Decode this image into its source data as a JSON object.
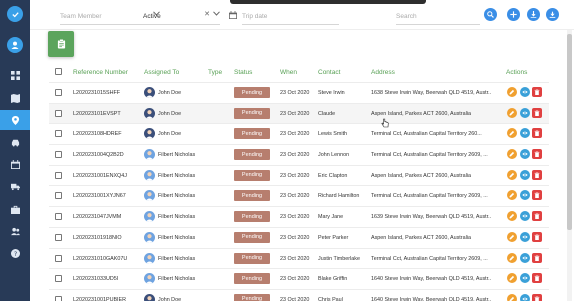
{
  "topbar": {
    "team_member_placeholder": "Team Member",
    "status_value": "Active",
    "trip_date_placeholder": "Trip date",
    "search_placeholder": "Search"
  },
  "table": {
    "headers": {
      "reference": "Reference Number",
      "assigned": "Assigned To",
      "type": "Type",
      "status": "Status",
      "when": "When",
      "contact": "Contact",
      "address": "Address",
      "actions": "Actions"
    },
    "rows": [
      {
        "ref": "L2020231015SHFF",
        "assigned": "John Doe",
        "avatar": "dark",
        "type": "",
        "status": "Pending",
        "when": "23 Oct 2020",
        "contact": "Steve Irwin",
        "address": "1638 Steve Irwin Way, Beerwah QLD 4519, Austr..."
      },
      {
        "ref": "L202023101EVSPT",
        "assigned": "John Doe",
        "avatar": "dark",
        "type": "",
        "status": "Pending",
        "when": "23 Oct 2020",
        "contact": "Claude",
        "address": "Aspen Island, Parkes ACT 2600, Australia"
      },
      {
        "ref": "L202023108HDREF",
        "assigned": "John Doe",
        "avatar": "dark",
        "type": "",
        "status": "Pending",
        "when": "23 Oct 2020",
        "contact": "Lewis Smith",
        "address": "Terminal Cct, Australian Capital Territory 260..."
      },
      {
        "ref": "L2020231004Q2B2D",
        "assigned": "Filbert Nicholas",
        "avatar": "light",
        "type": "",
        "status": "Pending",
        "when": "23 Oct 2020",
        "contact": "John Lennon",
        "address": "Terminal Cct, Australian Capital Territory 2609, ..."
      },
      {
        "ref": "L2020231001ENXQ4J",
        "assigned": "Filbert Nicholas",
        "avatar": "light",
        "type": "",
        "status": "Pending",
        "when": "23 Oct 2020",
        "contact": "Eric Clapton",
        "address": "Aspen Island, Parkes ACT 2600, Australia"
      },
      {
        "ref": "L2020231001XYJN67",
        "assigned": "Filbert Nicholas",
        "avatar": "light",
        "type": "",
        "status": "Pending",
        "when": "23 Oct 2020",
        "contact": "Richard Hamilton",
        "address": "Terminal Cct, Australian Capital Territory 2609, ..."
      },
      {
        "ref": "L2020231047JVMM",
        "assigned": "Filbert Nicholas",
        "avatar": "light",
        "type": "",
        "status": "Pending",
        "when": "23 Oct 2020",
        "contact": "Mary Jane",
        "address": "1639 Steve Irwin Way, Beerwah QLD 4519, Austr..."
      },
      {
        "ref": "L202023101918NIO",
        "assigned": "Filbert Nicholas",
        "avatar": "light",
        "type": "",
        "status": "Pending",
        "when": "23 Oct 2020",
        "contact": "Peter Parker",
        "address": "Aspen Island, Parkes ACT 2600, Australia"
      },
      {
        "ref": "L2020231010GAK07U",
        "assigned": "Filbert Nicholas",
        "avatar": "light",
        "type": "",
        "status": "Pending",
        "when": "23 Oct 2020",
        "contact": "Justin Timberlake",
        "address": "Terminal Cct, Australian Capital Territory 2609, ..."
      },
      {
        "ref": "L2020231033UD5I",
        "assigned": "Filbert Nicholas",
        "avatar": "light",
        "type": "",
        "status": "Pending",
        "when": "23 Oct 2020",
        "contact": "Blake Griffin",
        "address": "1640 Steve Irwin Way, Beerwah QLD 4519, Austr..."
      },
      {
        "ref": "L2020231001PUBIER",
        "assigned": "John Doe",
        "avatar": "dark",
        "type": "",
        "status": "Pending",
        "when": "23 Oct 2020",
        "contact": "Chris Paul",
        "address": "1640 Steve Irwin Way, Beerwah QLD 4519, Austr..."
      }
    ]
  },
  "colors": {
    "sidebar": "#283a57",
    "accent_blue": "#3aa0e8",
    "header_green": "#58a055",
    "pending_badge": "#b77e6e",
    "edit": "#f0a030",
    "view": "#3aa0d8",
    "delete": "#e04040"
  },
  "icons": [
    "check-logo-icon",
    "user-avatar-icon",
    "dashboard-icon",
    "map-icon",
    "location-pin-icon",
    "car-icon",
    "calendar-icon",
    "truck-icon",
    "briefcase-icon",
    "users-icon",
    "help-icon",
    "search-icon",
    "add-icon",
    "download-icon",
    "export-icon",
    "pencil-icon",
    "eye-icon",
    "trash-icon",
    "clipboard-icon"
  ]
}
